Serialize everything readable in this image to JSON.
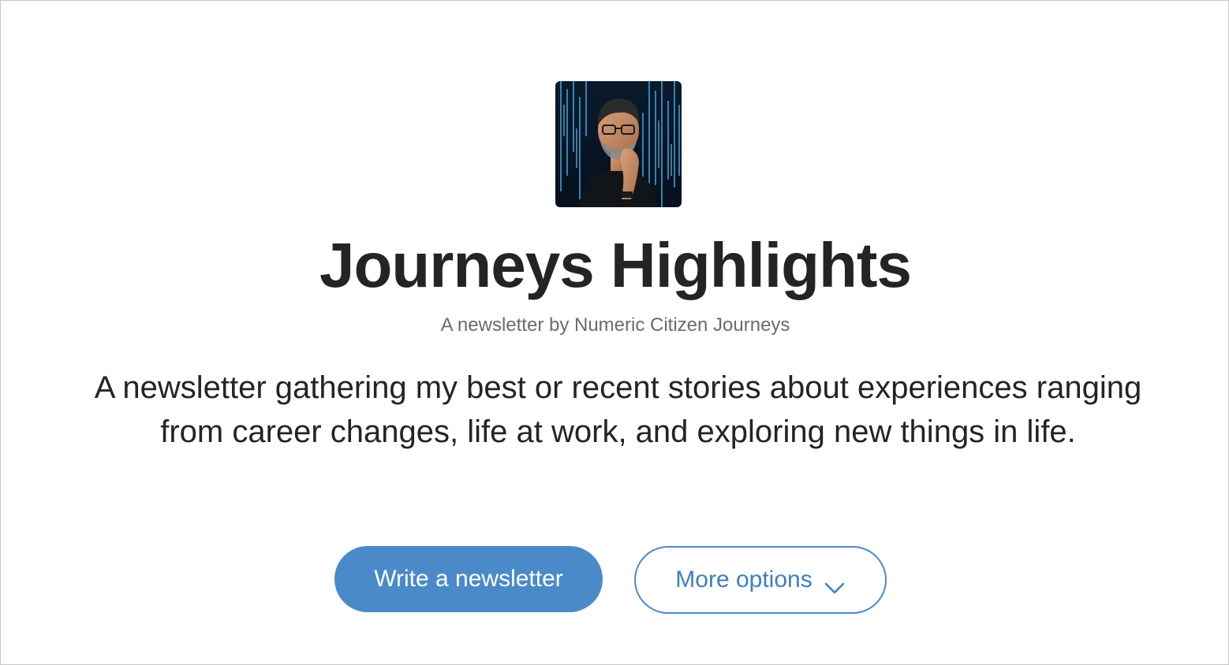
{
  "newsletter": {
    "title": "Journeys Highlights",
    "byline": "A newsletter by Numeric Citizen Journeys",
    "description": "A newsletter gathering my best or recent stories about experiences ranging from career changes, life at work, and exploring new things in life.",
    "avatar_alt": "Numeric Citizen Journeys"
  },
  "actions": {
    "primary_label": "Write a newsletter",
    "secondary_label": "More options",
    "secondary_icon": "chevron-down-icon"
  },
  "colors": {
    "accent": "#4a8ac9",
    "title_text": "#242424",
    "muted_text": "#6b6b6b"
  }
}
